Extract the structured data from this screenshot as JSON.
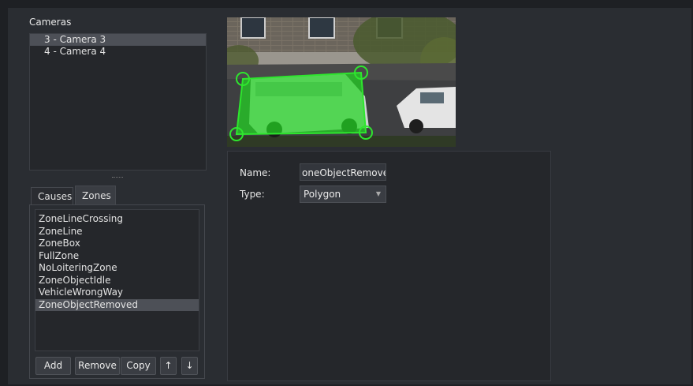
{
  "cameras": {
    "label": "Cameras",
    "items": [
      "3 - Camera 3",
      "4 - Camera 4"
    ],
    "selected_index": 0
  },
  "tabs": [
    {
      "label": "Causes",
      "active": false
    },
    {
      "label": "Zones",
      "active": true
    }
  ],
  "zones": {
    "items": [
      "ZoneLineCrossing",
      "ZoneLine",
      "ZoneBox",
      "FullZone",
      "NoLoiteringZone",
      "ZoneObjectIdle",
      "VehicleWrongWay",
      "ZoneObjectRemoved"
    ],
    "selected_index": 7
  },
  "buttons": {
    "add": "Add",
    "remove": "Remove",
    "copy": "Copy",
    "move_up": "↑",
    "move_down": "↓"
  },
  "properties": {
    "name_label": "Name:",
    "name_value": "oneObjectRemoved",
    "type_label": "Type:",
    "type_value": "Polygon"
  },
  "colors": {
    "zone_fill": "#22d622",
    "zone_stroke": "#2ee62e",
    "selection": "#4d5057"
  }
}
